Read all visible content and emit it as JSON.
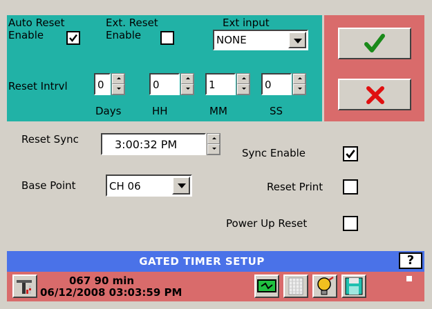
{
  "reset_panel": {
    "auto_reset_line1": "Auto Reset",
    "auto_reset_line2": "Enable",
    "auto_reset_checked": true,
    "ext_reset_line1": "Ext. Reset",
    "ext_reset_line2": "Enable",
    "ext_reset_checked": false,
    "ext_input_label": "Ext input",
    "ext_input_value": "NONE",
    "interval_label": "Reset Intrvl",
    "days_value": "0",
    "hh_value": "0",
    "mm_value": "1",
    "ss_value": "0",
    "days_label": "Days",
    "hh_label": "HH",
    "mm_label": "MM",
    "ss_label": "SS"
  },
  "actions": {
    "ok_icon": "green-checkmark-icon",
    "cancel_icon": "red-x-icon"
  },
  "sync": {
    "reset_sync_label": "Reset Sync",
    "reset_sync_value": "3:00:32 PM",
    "sync_enable_label": "Sync  Enable",
    "sync_enable_checked": true,
    "base_point_label": "Base Point",
    "base_point_value": "CH 06",
    "reset_print_label": "Reset Print",
    "reset_print_checked": false,
    "power_up_reset_label": "Power Up Reset",
    "power_up_reset_checked": false
  },
  "title_bar": {
    "title": "GATED TIMER SETUP",
    "help_label": "?"
  },
  "status_bar": {
    "status_line1": "067 90 min",
    "status_line2": "06/12/2008 03:03:59 PM",
    "icons": [
      "tools-icon",
      "switch-icon",
      "log-pages-icon",
      "alarm-bulb-icon",
      "save-disk-icon"
    ]
  },
  "colors": {
    "teal_panel": "#21b2a6",
    "red_panel": "#d96b6b",
    "title_bar": "#4a72e8",
    "background": "#d4d0c8"
  }
}
